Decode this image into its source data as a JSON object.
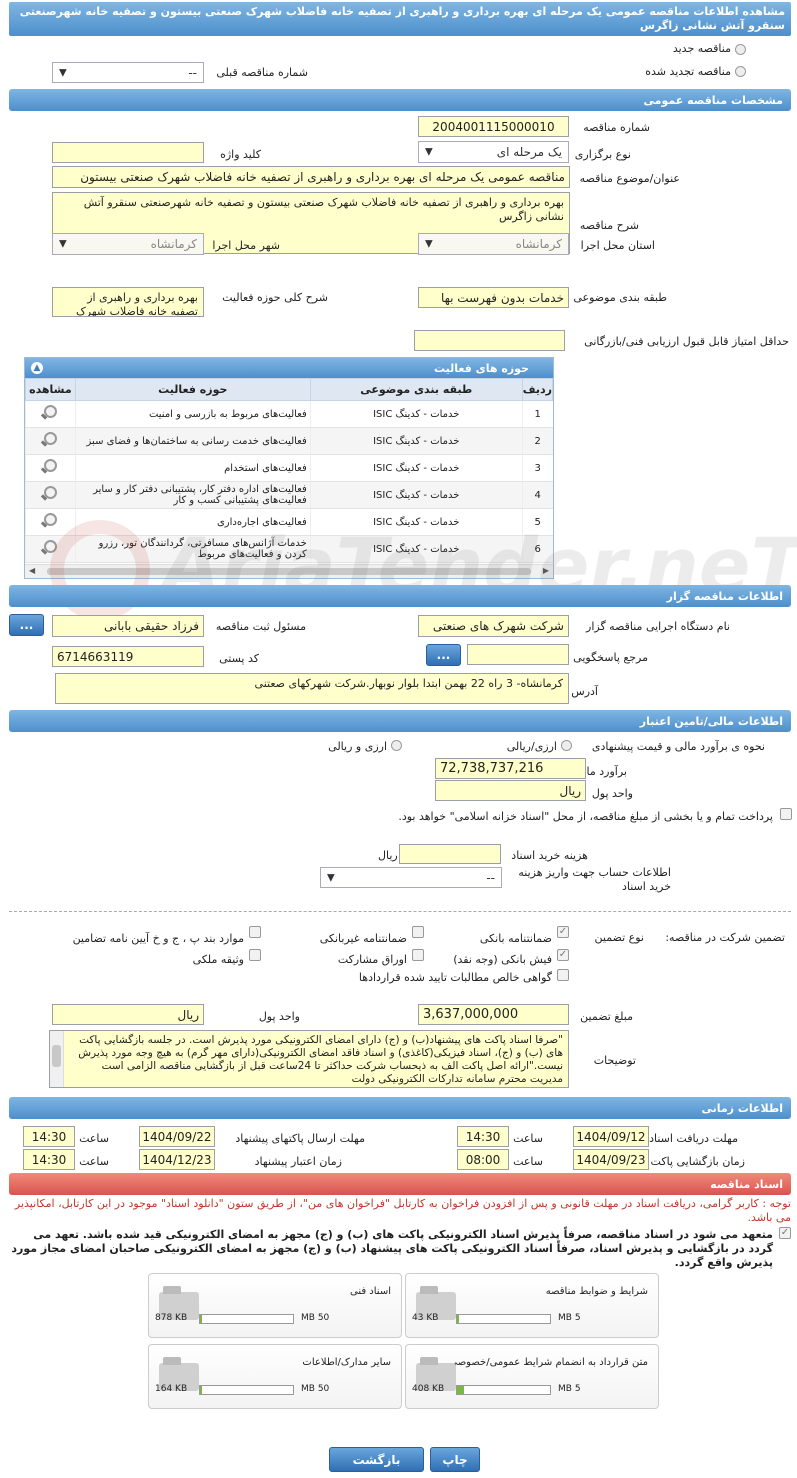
{
  "header": {
    "title": "مشاهده اطلاعات مناقصه عمومی یک مرحله ای بهره برداری و راهبری از تصفیه خانه فاضلاب شهرک صنعتی بیستون و تصفیه خانه شهرصنعتی سنقرو آتش نشانی زاگرس"
  },
  "top": {
    "radio_new": "مناقصه جدید",
    "radio_renewed": "مناقصه تجدید شده",
    "prev_number_label": "شماره مناقصه قبلی",
    "prev_number_value": "--"
  },
  "general": {
    "section_title": "مشخصات مناقصه عمومی",
    "number_label": "شماره مناقصه",
    "number_value": "2004001115000010",
    "type_label": "نوع برگزاری",
    "type_value": "یک مرحله ای",
    "keyword_label": "کلید واژه",
    "keyword_value": "",
    "subject_label": "عنوان/موضوع مناقصه",
    "subject_value": "مناقصه عمومی یک مرحله ای بهره برداری و راهبری از تصفیه خانه فاضلاب شهرک صنعتی بیستون",
    "desc_label": "شرح مناقصه",
    "desc_value": "بهره برداری و راهبری از تصفیه خانه فاضلاب شهرک صنعتی بیستون و تصفیه خانه شهرصنعتی سنقرو آتش نشانی زاگرس",
    "province_label": "استان محل اجرا",
    "province_value": "کرمانشاه",
    "city_label": "شهر محل اجرا",
    "city_value": "کرمانشاه",
    "category_label": "طبقه بندی موضوعی",
    "category_value": "خدمات بدون فهرست بها",
    "scope_label": "شرح کلی حوزه فعالیت",
    "scope_value": "بهره برداری و راهبری از تصفیه خانه فاضلاب شهرک",
    "min_score_label": "حداقل امتیاز قابل قبول ارزیابی فنی/بازرگانی",
    "min_score_value": ""
  },
  "activities": {
    "title": "حوزه های فعالیت",
    "columns": [
      "ردیف",
      "طبقه بندی موضوعی",
      "حوزه فعالیت",
      "مشاهده"
    ],
    "rows": [
      {
        "n": "1",
        "cat": "خدمات - کدینگ ISIC",
        "act": "فعالیت‌های مربوط به بازرسی و امنیت"
      },
      {
        "n": "2",
        "cat": "خدمات - کدینگ ISIC",
        "act": "فعالیت‌های خدمت رسانی به ساختمان‌ها و فضای سبز"
      },
      {
        "n": "3",
        "cat": "خدمات - کدینگ ISIC",
        "act": "فعالیت‌های استخدام"
      },
      {
        "n": "4",
        "cat": "خدمات - کدینگ ISIC",
        "act": "فعالیت‌های  اداره دفتر کار، پشتیبانی دفتر کار و سایر  فعالیت‌های پشتیبانی کسب و کار"
      },
      {
        "n": "5",
        "cat": "خدمات - کدینگ ISIC",
        "act": "فعالیت‌های اجاره‌داری"
      },
      {
        "n": "6",
        "cat": "خدمات - کدینگ ISIC",
        "act": "خدمات آژانس‌های مسافرتی، گردانندگان تور، رزرو کردن و فعالیت‌های مربوط"
      }
    ]
  },
  "organizer": {
    "section_title": "اطلاعات مناقصه گزار",
    "org_label": "نام دستگاه اجرایی مناقصه گزار",
    "org_value": "شرکت شهرک های صنعتی",
    "officer_label": "مسئول ثبت مناقصه",
    "officer_value": "فرزاد حقیقی بابانی",
    "ref_label": "مرجع پاسخگویی",
    "ref_value": "",
    "postal_label": "کد پستی",
    "postal_value": "6714663119",
    "address_label": "آدرس",
    "address_value": "کرمانشاه- 3 راه 22 بهمن ابتدا بلوار نوبهار.شرکت شهرکهای صعتنی",
    "dots": "..."
  },
  "finance": {
    "section_title": "اطلاعات مالی/تامین اعتبار",
    "estimate_label": "نحوه ی برآورد مالی و قیمت پیشنهادی",
    "opt_rial": "ارزی/ریالی",
    "opt_fx": "ارزی و ریالی",
    "estimate_amount_label": "برآورد مالی",
    "estimate_amount_value": "72,738,737,216",
    "currency_label": "واحد پول",
    "currency_value": "ریال",
    "treasury_text": "پرداخت تمام و یا بخشی از مبلغ مناقصه، از محل \"اسناد خزانه اسلامی\" خواهد بود.",
    "doc_fee_label": "هزینه خرید اسناد",
    "doc_fee_unit": "ریال",
    "doc_fee_value": "",
    "account_label": "اطلاعات حساب جهت واریز هزینه خرید اسناد",
    "account_value": "--"
  },
  "guarantee": {
    "participation_label": "تضمین شرکت در مناقصه:",
    "type_label": "نوع تضمین",
    "opts": {
      "bank_guarantee": "ضمانتنامه بانکی",
      "nonbank_guarantee": "ضمانتنامه غیربانکی",
      "clauses": "موارد بند پ ، ج و خ آیین نامه تضامین",
      "bank_receipt": "فیش بانکی (وجه نقد)",
      "bonds": "اوراق مشارکت",
      "property": "وثیقه ملکی",
      "claims": "گواهی خالص مطالبات تایید شده قراردادها"
    },
    "amount_label": "مبلغ تضمین",
    "amount_value": "3,637,000,000",
    "currency_label": "واحد پول",
    "currency_value": "ریال",
    "notes_label": "توضیحات",
    "notes_value": "\"صرفا اسناد پاکت های پیشنهاد(ب) و (ج) دارای امضای الکترونیکی مورد پذیرش است. در جلسه بازگشایی پاکت های (ب) و (ج)، اسناد فیزیکی(کاغذی) و اسناد فاقد امضای الکترونیکی(دارای مهر گرم) به هیچ وجه مورد پذیرش نیست.\"ارائه اصل پاکت الف به ذیحساب شرکت حداکثر تا 24ساعت قبل از بازگشایی مناقصه الزامی است مدیریت محترم سامانه تدارکات الکترونیکی دولت"
  },
  "timing": {
    "section_title": "اطلاعات زمانی",
    "receive_label": "مهلت دریافت اسناد",
    "receive_date": "1404/09/12",
    "receive_time": "14:30",
    "send_label": "مهلت ارسال پاکتهای پیشنهاد",
    "send_date": "1404/09/22",
    "send_time": "14:30",
    "open_label": "زمان بازگشایی پاکت ها",
    "open_date": "1404/09/23",
    "open_time": "08:00",
    "validity_label": "زمان اعتبار پیشنهاد",
    "validity_date": "1404/12/23",
    "validity_time": "14:30",
    "time_label": "ساعت"
  },
  "documents": {
    "section_title": "اسناد مناقصه",
    "warning": "توجه : کاربر گرامی، دریافت اسناد در مهلت قانونی و پس از افزودن فراخوان به کارتابل \"فراخوان های من\"، از طریق ستون \"دانلود اسناد\" موجود در این کارتابل، امکانپذیر می باشد.",
    "commitment": "متعهد می شود در اسناد مناقصه، صرفاً پذیرش اسناد الکترونیکی پاکت های (ب) و (ج) مجهز به امضای الکترونیکی قید شده باشد. تعهد می گردد در بازگشایی و پذیرش اسناد، صرفاً اسناد الکترونیکی پاکت های پیشنهاد (ب) و (ج) مجهز به امضای الکترونیکی صاحبان امضای مجاز مورد پذیرش واقع گردد.",
    "files": [
      {
        "name": "شرایط و ضوابط مناقصه",
        "max": "5 MB",
        "size": "43 KB",
        "fill": 0.01
      },
      {
        "name": "اسناد فنی",
        "max": "50 MB",
        "size": "878 KB",
        "fill": 0.02
      },
      {
        "name": "متن قرارداد به انضمام شرایط عمومی/خصوصی",
        "max": "5 MB",
        "size": "408 KB",
        "fill": 0.08
      },
      {
        "name": "سایر مدارک/اطلاعات",
        "max": "50 MB",
        "size": "164 KB",
        "fill": 0.01
      }
    ]
  },
  "footer": {
    "print": "چاپ",
    "back": "بازگشت"
  },
  "watermark": "AriaTender.neT"
}
